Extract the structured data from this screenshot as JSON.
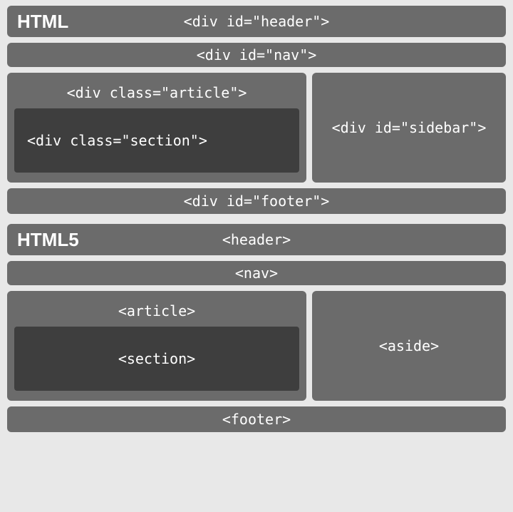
{
  "html4": {
    "title": "HTML",
    "header": "<div id=\"header\">",
    "nav": "<div id=\"nav\">",
    "article": "<div class=\"article\">",
    "section": "<div class=\"section\">",
    "sidebar": "<div id=\"sidebar\">",
    "footer": "<div id=\"footer\">"
  },
  "html5": {
    "title": "HTML5",
    "header": "<header>",
    "nav": "<nav>",
    "article": "<article>",
    "section": "<section>",
    "sidebar": "<aside>",
    "footer": "<footer>"
  }
}
